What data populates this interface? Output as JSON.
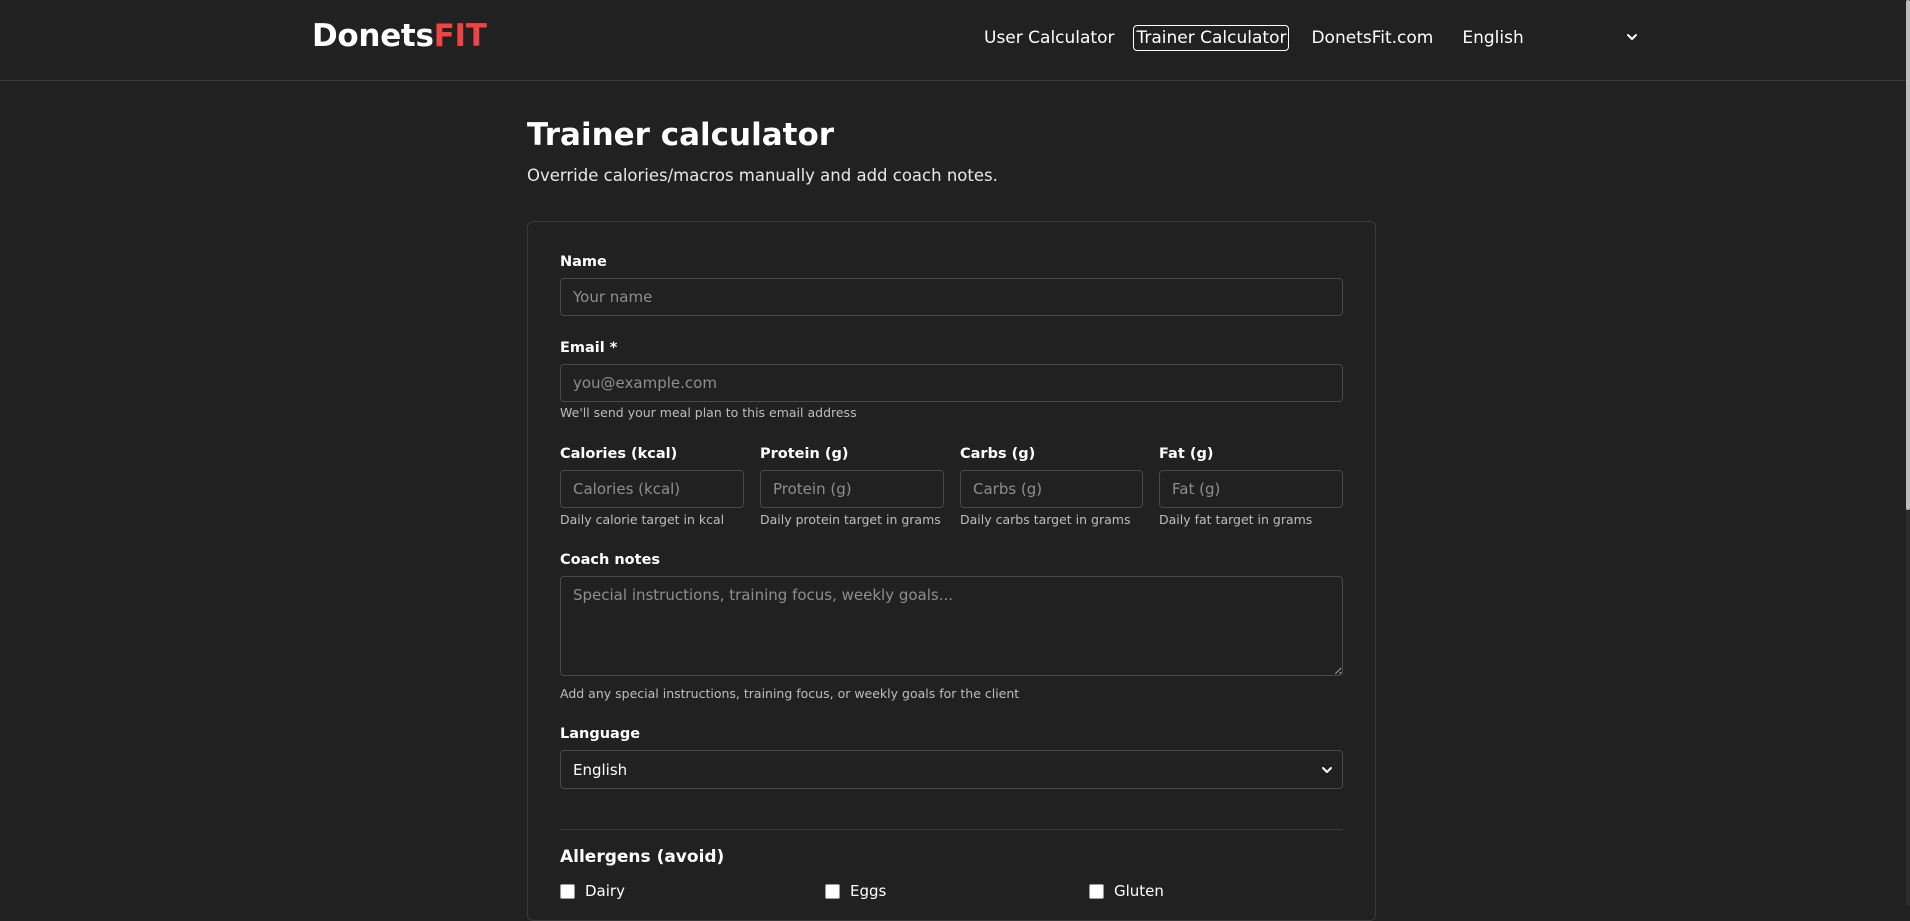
{
  "header": {
    "brand_main": "Donets",
    "brand_accent": "FIT",
    "nav": {
      "user_calculator": "User Calculator",
      "trainer_calculator": "Trainer Calculator",
      "site": "DonetsFit.com"
    },
    "language_selected": "English"
  },
  "page": {
    "title": "Trainer calculator",
    "subtitle": "Override calories/macros manually and add coach notes."
  },
  "form": {
    "name": {
      "label": "Name",
      "placeholder": "Your name"
    },
    "email": {
      "label": "Email *",
      "placeholder": "you@example.com",
      "help": "We'll send your meal plan to this email address"
    },
    "calories": {
      "label": "Calories (kcal)",
      "placeholder": "Calories (kcal)",
      "help": "Daily calorie target in kcal"
    },
    "protein": {
      "label": "Protein (g)",
      "placeholder": "Protein (g)",
      "help": "Daily protein target in grams"
    },
    "carbs": {
      "label": "Carbs (g)",
      "placeholder": "Carbs (g)",
      "help": "Daily carbs target in grams"
    },
    "fat": {
      "label": "Fat (g)",
      "placeholder": "Fat (g)",
      "help": "Daily fat target in grams"
    },
    "coach_notes": {
      "label": "Coach notes",
      "placeholder": "Special instructions, training focus, weekly goals...",
      "help": "Add any special instructions, training focus, or weekly goals for the client"
    },
    "language": {
      "label": "Language",
      "selected": "English"
    },
    "allergens": {
      "title": "Allergens (avoid)",
      "items": [
        "Dairy",
        "Eggs",
        "Gluten"
      ]
    }
  },
  "colors": {
    "background": "#212121",
    "brand_accent": "#ef4444",
    "border": "#4a4a4a"
  },
  "icons": {
    "header_language": "chevron-down-icon",
    "form_language": "chevron-down-icon"
  }
}
